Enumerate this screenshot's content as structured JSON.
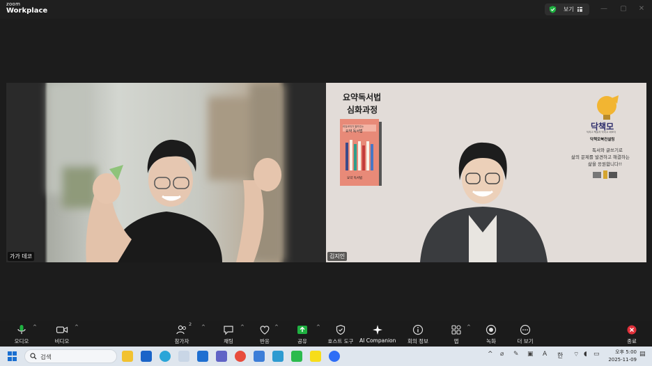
{
  "app": {
    "logo_small": "zoom",
    "logo_big": "Workplace"
  },
  "titlebar": {
    "view_label": "보기"
  },
  "participants": [
    {
      "name": "가가 데코"
    },
    {
      "name": "김지인"
    }
  ],
  "slide": {
    "title_line1": "요약독서법",
    "title_line2": "심화과정",
    "book_small_text": "리딩코치가 알려주는",
    "book_title": "요약 독서법",
    "book_bottom": "요약 독서법",
    "brand": "닥책모",
    "brand_sub": "닥치고 책읽자 닥치고 써보자",
    "brand_company": "닥책모북컨설팅",
    "msg1": "독서와 글쓰기로",
    "msg2": "삶의 문제를 발견하고 해결하는",
    "msg3": "삶을 응원합니다!!"
  },
  "toolbar": {
    "audio": "오디오",
    "video": "비디오",
    "participants": "참가자",
    "participants_count": "2",
    "chat": "채팅",
    "reactions": "반응",
    "share": "공유",
    "host_tools": "호스트 도구",
    "ai_companion": "AI Companion",
    "meeting_info": "회의 정보",
    "apps": "앱",
    "record": "녹화",
    "more": "더 보기",
    "end": "종료"
  },
  "taskbar": {
    "search_placeholder": "검색",
    "ime_a": "A",
    "ime_han": "한",
    "time": "오후 5:00",
    "date": "2025-11-09"
  },
  "colors": {
    "accent_green": "#1fb141",
    "end_red": "#e0303a",
    "taskbar_bg": "#dfe6ee",
    "slide_bg": "#e2dcd8"
  }
}
